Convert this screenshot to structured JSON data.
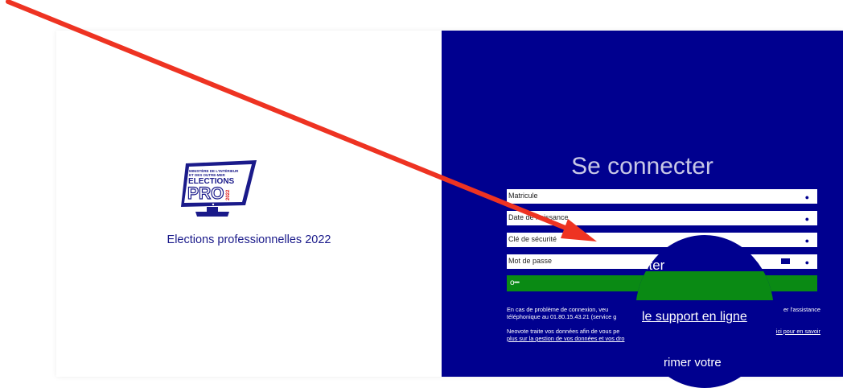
{
  "left": {
    "subtitle": "Elections professionnelles 2022"
  },
  "logo": {
    "line1": "MINISTÈRE DE L'INTÉRIEUR",
    "line2": "ET DES OUTRE-MER",
    "line3": "ELECTIONS",
    "line4": "PRO",
    "year": "2022"
  },
  "form": {
    "title": "Se connecter",
    "fields": [
      {
        "placeholder": "Matricule"
      },
      {
        "placeholder": "Date de naissance"
      },
      {
        "placeholder": "Clé de sécurité"
      },
      {
        "placeholder": "Mot de passe"
      }
    ],
    "eye_icon": "●",
    "login_icon": "o━"
  },
  "info": {
    "support_pre": "En cas de problème de connexion, veu",
    "support_post": "er l'assistance",
    "phone_pre": "téléphonique au 01.80.15.43.21 (service g",
    "privacy_pre": "Neovote traite vos données afin de vous pe",
    "privacy_link_end": "ici pour en savoir",
    "privacy_link2": "plus sur la gestion de vos données et vos dro"
  },
  "magnifier": {
    "button_text": "cter",
    "support_link": "le support en ligne",
    "bottom_text": "rimer votre"
  },
  "colors": {
    "panel": "#00008f",
    "button": "#0a8a14",
    "arrow": "#ee3322"
  }
}
